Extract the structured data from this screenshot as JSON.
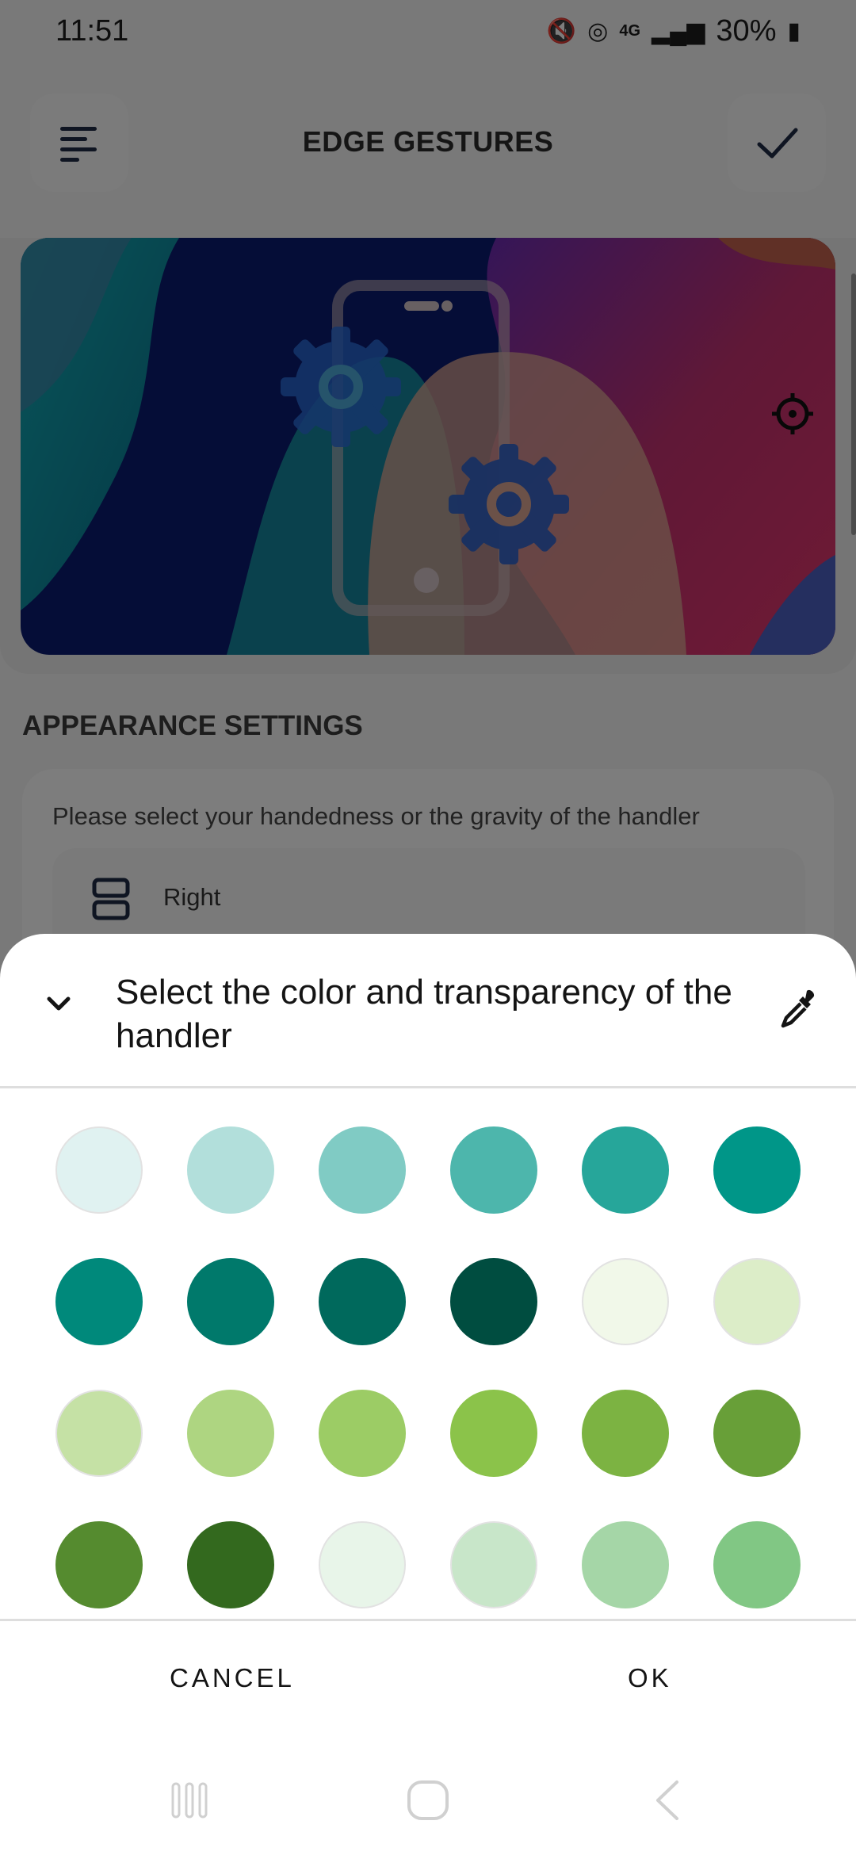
{
  "status_bar": {
    "time": "11:51",
    "battery": "30%"
  },
  "app_bar": {
    "title": "EDGE GESTURES"
  },
  "section": {
    "title": "APPEARANCE SETTINGS"
  },
  "handedness": {
    "description": "Please select your handedness or the gravity of the handler",
    "selected": "Right"
  },
  "sheet": {
    "title": "Select the color and transparency of the handler",
    "cancel_label": "CANCEL",
    "ok_label": "OK"
  },
  "swatches": [
    "#E0F2F1",
    "#B2DFDB",
    "#80CBC4",
    "#4DB6AC",
    "#26A69A",
    "#009688",
    "#00897B",
    "#00796B",
    "#00695C",
    "#004D40",
    "#F1F8E9",
    "#DCEDC8",
    "#C5E1A5",
    "#AED581",
    "#9CCC65",
    "#8BC34A",
    "#7CB342",
    "#689F38",
    "#558B2F",
    "#33691E",
    "#E8F5E9",
    "#C8E6C9",
    "#A5D6A7",
    "#81C784"
  ]
}
